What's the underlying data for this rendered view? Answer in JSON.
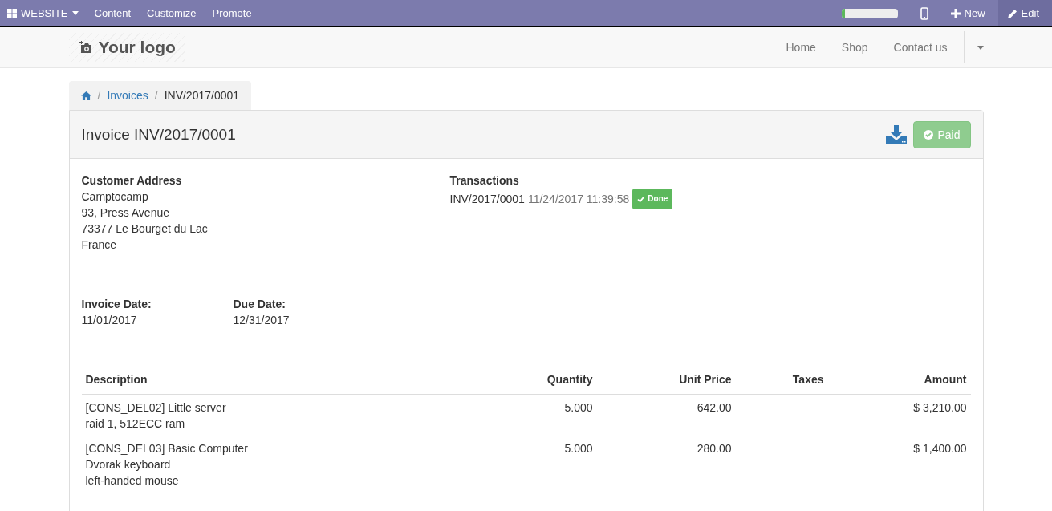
{
  "topbar": {
    "menu": "WEBSITE",
    "items": [
      "Content",
      "Customize",
      "Promote"
    ],
    "progress": {
      "level": 0.07
    },
    "new": "New",
    "edit": "Edit"
  },
  "header": {
    "logo": "Your logo",
    "nav": [
      "Home",
      "Shop",
      "Contact us"
    ]
  },
  "breadcrumb": [
    {
      "label": "/",
      "kind": "separator"
    },
    {
      "label": "Invoices",
      "kind": "link"
    },
    {
      "label": "/",
      "kind": "separator"
    },
    {
      "label": "INV/2017/0001",
      "kind": "current"
    }
  ],
  "invoice": {
    "title": "Invoice INV/2017/0001",
    "status": "Paid",
    "address": {
      "heading": "Customer Address",
      "lines": [
        "Camptocamp",
        "93, Press Avenue",
        "73377 Le Bourget du Lac",
        "France"
      ]
    },
    "transactions": {
      "heading": "Transactions",
      "items": [
        {
          "ref": "INV/2017/0001",
          "date": "11/24/2017 11:39:58",
          "state": "Done"
        }
      ]
    },
    "dates": [
      {
        "label": "Invoice Date:",
        "value": "11/01/2017"
      },
      {
        "label": "Due Date:",
        "value": "12/31/2017"
      }
    ],
    "table": {
      "columns": [
        "Description",
        "Quantity",
        "Unit Price",
        "Taxes",
        "Amount"
      ],
      "rows": [
        {
          "description": [
            "[CONS_DEL02] Little server",
            "raid 1, 512ECC ram"
          ],
          "quantity": "5.000",
          "unit_price": "642.00",
          "amount": "$ 3,210.00"
        },
        {
          "description": [
            "[CONS_DEL03] Basic Computer",
            "Dvorak keyboard",
            "left-handed mouse"
          ],
          "quantity": "5.000",
          "unit_price": "280.00",
          "amount": "$ 1,400.00"
        }
      ]
    }
  }
}
